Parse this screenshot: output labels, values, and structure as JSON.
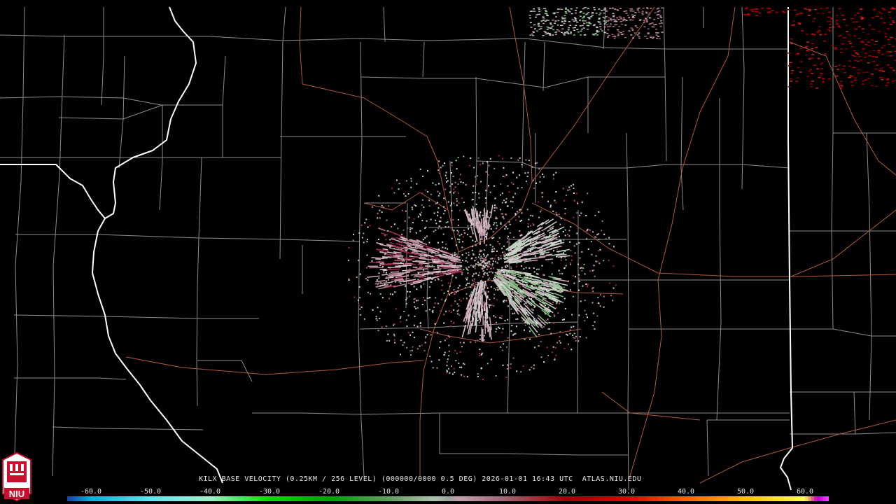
{
  "caption": {
    "product": "KILX BASE VELOCITY (0.25KM / 256 LEVEL) (000000/0000 0.5 DEG) 2026-01-01 16:43 UTC  ATLAS.NIU.EDU"
  },
  "logo": {
    "text": "NIU",
    "color": "#c8102e"
  },
  "scale": {
    "unit_note": "",
    "ticks": [
      "-60.0",
      "-50.0",
      "-40.0",
      "-30.0",
      "-20.0",
      "-10.0",
      "0.0",
      "10.0",
      "20.0",
      "30.0",
      "40.0",
      "50.0",
      "60.0"
    ],
    "tick_values": [
      -60,
      -50,
      -40,
      -30,
      -20,
      -10,
      0,
      10,
      20,
      30,
      40,
      50,
      60
    ],
    "min": -64,
    "max": 64,
    "stops": [
      {
        "v": -64,
        "color": "#1a3fa0"
      },
      {
        "v": -60,
        "color": "#00b4d8"
      },
      {
        "v": -50,
        "color": "#66e0f0"
      },
      {
        "v": -40,
        "color": "#9ef0c8"
      },
      {
        "v": -30,
        "color": "#00e000"
      },
      {
        "v": -20,
        "color": "#00a000"
      },
      {
        "v": -10,
        "color": "#5f9f5f"
      },
      {
        "v": -2,
        "color": "#b0c0b0"
      },
      {
        "v": 0,
        "color": "#a0a0a0"
      },
      {
        "v": 2,
        "color": "#c0a0b0"
      },
      {
        "v": 10,
        "color": "#a06070"
      },
      {
        "v": 20,
        "color": "#a00000"
      },
      {
        "v": 30,
        "color": "#e00000"
      },
      {
        "v": 40,
        "color": "#ff6000"
      },
      {
        "v": 50,
        "color": "#ffc000"
      },
      {
        "v": 60,
        "color": "#ffff40"
      },
      {
        "v": 62,
        "color": "#c000c0"
      },
      {
        "v": 64,
        "color": "#ff40ff"
      }
    ]
  },
  "colors": {
    "background": "#000000",
    "county_lines": "#8c8c8c",
    "state_lines": "#ffffff",
    "highways": "#b05a3a"
  }
}
